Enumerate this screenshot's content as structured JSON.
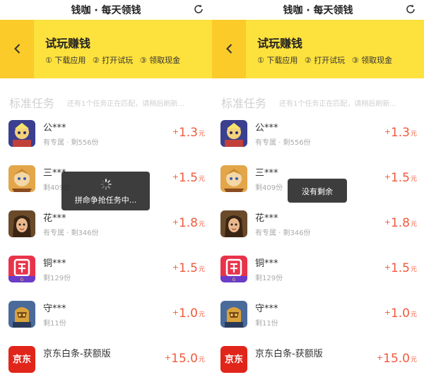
{
  "app_title": "钱咖 · 每天领钱",
  "header": {
    "title": "试玩赚钱",
    "steps": [
      "① 下载应用",
      "② 打开试玩",
      "③ 领取现金"
    ]
  },
  "section": {
    "title": "标准任务",
    "note": "还有1个任务正在匹配，请稍后刷新..."
  },
  "reward_unit": "元",
  "reward_plus": "+",
  "tasks": [
    {
      "name": "公***",
      "sub": "有专属 · 剩556份",
      "amount": "1.3",
      "icon": "game-hero-icon"
    },
    {
      "name": "三***",
      "sub": "剩409份",
      "amount": "1.5",
      "icon": "game-warrior-icon"
    },
    {
      "name": "花***",
      "sub": "有专属 · 剩346份",
      "amount": "1.8",
      "icon": "game-girl-icon"
    },
    {
      "name": "铜***",
      "sub": "剩129份",
      "amount": "1.5",
      "icon": "tong-app-icon"
    },
    {
      "name": "守***",
      "sub": "剩11份",
      "amount": "1.0",
      "icon": "game-knight-icon"
    },
    {
      "name": "京东白条-获额版",
      "sub": "",
      "amount": "15.0",
      "icon": "jd-logo-icon",
      "logo_text": "京东"
    }
  ],
  "toasts": {
    "loading": "拼命争抢任务中...",
    "sold_out": "没有剩余"
  },
  "colors": {
    "header_bg": "#fde13d",
    "back_bg": "#fbcb2a",
    "reward": "#f15a3d",
    "toast_bg": "#222222"
  }
}
